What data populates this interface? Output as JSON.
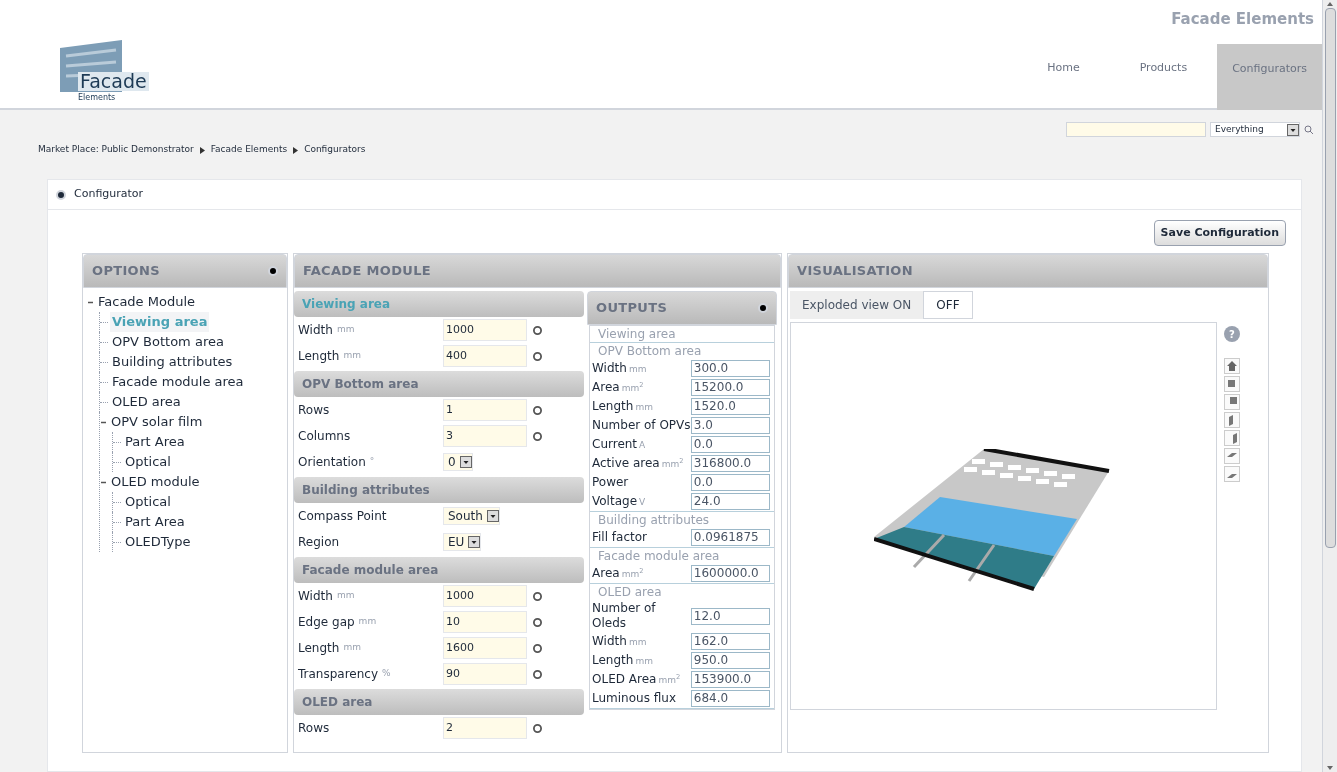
{
  "header": {
    "site_title": "Facade Elements",
    "logo_text": "Facade",
    "logo_subtext": "Elements",
    "nav": [
      {
        "label": "Home",
        "selected": false
      },
      {
        "label": "Products",
        "selected": false
      },
      {
        "label": "Configurators",
        "selected": true
      }
    ]
  },
  "search": {
    "scope": "Everything"
  },
  "breadcrumb": [
    "Market Place: Public Demonstrator",
    "Facade Elements",
    "Configurators"
  ],
  "configurator_bar": {
    "title": "Configurator"
  },
  "save_button": "Save Configuration",
  "options": {
    "title": "OPTIONS",
    "tree": [
      {
        "label": "Facade Module",
        "expanded": true,
        "selected": false,
        "children": [
          {
            "label": "Viewing area",
            "selected": true
          },
          {
            "label": "OPV Bottom area",
            "selected": false
          },
          {
            "label": "Building attributes",
            "selected": false
          },
          {
            "label": "Facade module area",
            "selected": false
          },
          {
            "label": "OLED area",
            "selected": false
          },
          {
            "label": "OPV solar film",
            "expanded": true,
            "selected": false,
            "children": [
              {
                "label": "Part Area",
                "selected": false
              },
              {
                "label": "Optical",
                "selected": false
              }
            ]
          },
          {
            "label": "OLED module",
            "expanded": true,
            "selected": false,
            "children": [
              {
                "label": "Optical",
                "selected": false
              },
              {
                "label": "Part Area",
                "selected": false
              },
              {
                "label": "OLEDType",
                "selected": false
              }
            ]
          }
        ]
      }
    ]
  },
  "facade_module": {
    "title": "FACADE MODULE",
    "sections": [
      {
        "title": "Viewing area",
        "selected": true,
        "rows": [
          {
            "kind": "number",
            "label": "Width",
            "unit": "mm",
            "value": "1000"
          },
          {
            "kind": "number",
            "label": "Length",
            "unit": "mm",
            "value": "400"
          }
        ]
      },
      {
        "title": "OPV Bottom area",
        "selected": false,
        "rows": [
          {
            "kind": "number",
            "label": "Rows",
            "value": "1"
          },
          {
            "kind": "number",
            "label": "Columns",
            "value": "3"
          },
          {
            "kind": "select",
            "label": "Orientation",
            "unit": "°",
            "value": "0"
          }
        ]
      },
      {
        "title": "Building attributes",
        "selected": false,
        "rows": [
          {
            "kind": "select",
            "label": "Compass Point",
            "value": "South"
          },
          {
            "kind": "select",
            "label": "Region",
            "value": "EU"
          }
        ]
      },
      {
        "title": "Facade module area",
        "selected": false,
        "rows": [
          {
            "kind": "number",
            "label": "Width",
            "unit": "mm",
            "value": "1000"
          },
          {
            "kind": "number",
            "label": "Edge gap",
            "unit": "mm",
            "value": "10"
          },
          {
            "kind": "number",
            "label": "Length",
            "unit": "mm",
            "value": "1600"
          },
          {
            "kind": "number",
            "label": "Transparency",
            "unit": "%",
            "value": "90"
          }
        ]
      },
      {
        "title": "OLED area",
        "selected": false,
        "rows": [
          {
            "kind": "number",
            "label": "Rows",
            "value": "2"
          }
        ]
      }
    ]
  },
  "outputs": {
    "title": "OUTPUTS",
    "sections": [
      {
        "title": "Viewing area"
      },
      {
        "title": "OPV Bottom area",
        "rows": [
          {
            "label": "Width",
            "unit": "mm",
            "value": "300.0"
          },
          {
            "label": "Area",
            "unit": "mm$^{2}$",
            "value": "15200.0"
          },
          {
            "label": "Length",
            "unit": "mm",
            "value": "1520.0"
          },
          {
            "label": "Number of OPVs",
            "value": "3.0"
          },
          {
            "label": "Current",
            "unit": "A",
            "value": "0.0"
          },
          {
            "label": "Active area",
            "unit": "mm$^{2}$",
            "value": "316800.0"
          },
          {
            "label": "Power",
            "value": "0.0"
          },
          {
            "label": "Voltage",
            "unit": "V",
            "value": "24.0"
          }
        ]
      },
      {
        "title": "Building attributes",
        "rows": [
          {
            "label": "Fill factor",
            "value": "0.0961875"
          }
        ]
      },
      {
        "title": "Facade module area",
        "rows": [
          {
            "label": "Area",
            "unit": "mm$^{2}$",
            "value": "1600000.0"
          }
        ]
      },
      {
        "title": "OLED area",
        "rows": [
          {
            "label": "Number of Oleds",
            "value": "12.0"
          },
          {
            "label": "Width",
            "unit": "mm",
            "value": "162.0"
          },
          {
            "label": "Length",
            "unit": "mm",
            "value": "950.0"
          },
          {
            "label": "OLED Area",
            "unit": "mm$^{2}$",
            "value": "153900.0"
          },
          {
            "label": "Luminous flux",
            "value": "684.0"
          }
        ]
      }
    ]
  },
  "visualisation": {
    "title": "VISUALISATION",
    "toggle": [
      {
        "label": "Exploded view ON",
        "selected": false
      },
      {
        "label": "OFF",
        "selected": true
      }
    ],
    "help": "?"
  }
}
